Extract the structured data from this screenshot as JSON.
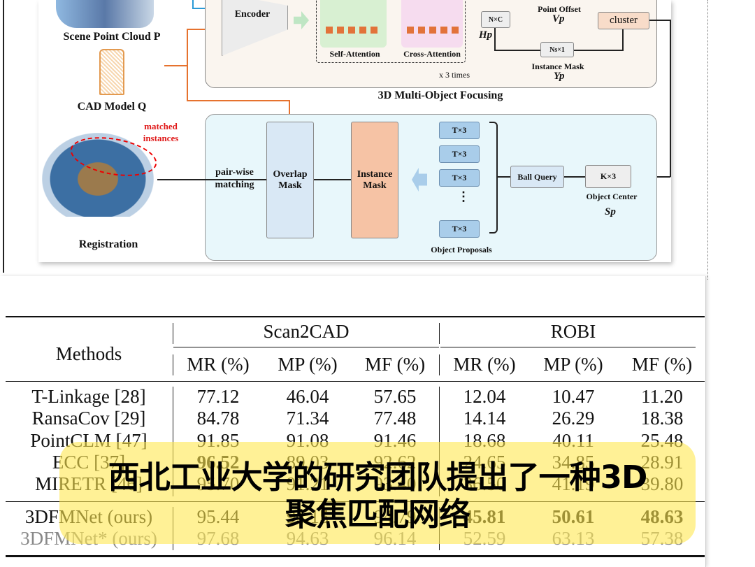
{
  "figure": {
    "scene_label": "Scene Point Cloud P",
    "cad_label": "CAD Model Q",
    "encoder": "Encoder",
    "self_attention": "Self-Attention",
    "cross_attention": "Cross-Attention",
    "repeat": "x 3 times",
    "nxc": "N×C",
    "hp": "Hp",
    "point_offset": "Point Offset",
    "vp": "Vp",
    "cluster": "cluster",
    "nsx1": "Ns×1",
    "instance_mask_label": "Instance Mask",
    "yp": "Yp",
    "focusing_title": "3D Multi-Object Focusing",
    "matched_instances": "matched instances",
    "registration": "Registration",
    "pairwise": "pair-wise matching",
    "overlap_mask": "Overlap Mask",
    "instance_mask": "Instance Mask",
    "proposal_box": "T×3",
    "proposals_label": "Object Proposals",
    "ball_query": "Ball Query",
    "kx3": "K×3",
    "object_center": "Object Center",
    "sp": "Sp"
  },
  "table": {
    "methods_header": "Methods",
    "groups": [
      "Scan2CAD",
      "ROBI"
    ],
    "columns": [
      "MR (%)",
      "MP (%)",
      "MF (%)",
      "MR (%)",
      "MP (%)",
      "MF (%)"
    ],
    "rows": [
      {
        "method": "T-Linkage [28]",
        "values": [
          "77.12",
          "46.04",
          "57.65",
          "12.04",
          "10.47",
          "11.20"
        ]
      },
      {
        "method": "RansaCov [29]",
        "values": [
          "84.78",
          "71.34",
          "77.48",
          "14.14",
          "26.29",
          "18.38"
        ]
      },
      {
        "method": "PointCLM [47]",
        "values": [
          "91.85",
          "91.08",
          "91.46",
          "18.68",
          "40.11",
          "25.48"
        ]
      },
      {
        "method": "ECC [37]",
        "values": [
          "96.52",
          "89.03",
          "92.62",
          "24.65",
          "34.85",
          "28.91"
        ]
      },
      {
        "method": "MIRETR [46]",
        "values": [
          "95.70",
          "91.21",
          "93.40",
          "36.50",
          "41.19",
          "39.80"
        ]
      },
      {
        "method": "3DFMNet (ours)",
        "values": [
          "95.44",
          "94.15",
          "94.79",
          "45.81",
          "50.61",
          "48.63"
        ]
      },
      {
        "method": "3DFMNet* (ours)",
        "values": [
          "97.68",
          "94.63",
          "96.14",
          "52.59",
          "63.13",
          "57.38"
        ]
      }
    ]
  },
  "subtitle": {
    "line1": "西北工业大学的研究团队提出了一种3D",
    "line2": "聚焦匹配网络"
  },
  "colors": {
    "subtitle_bg": "#ffe850",
    "panel_top": "#faf5ef",
    "panel_bottom": "#e8f7fb",
    "instance_mask": "#f6c3a5",
    "overlap_mask": "#d9e8f5"
  }
}
